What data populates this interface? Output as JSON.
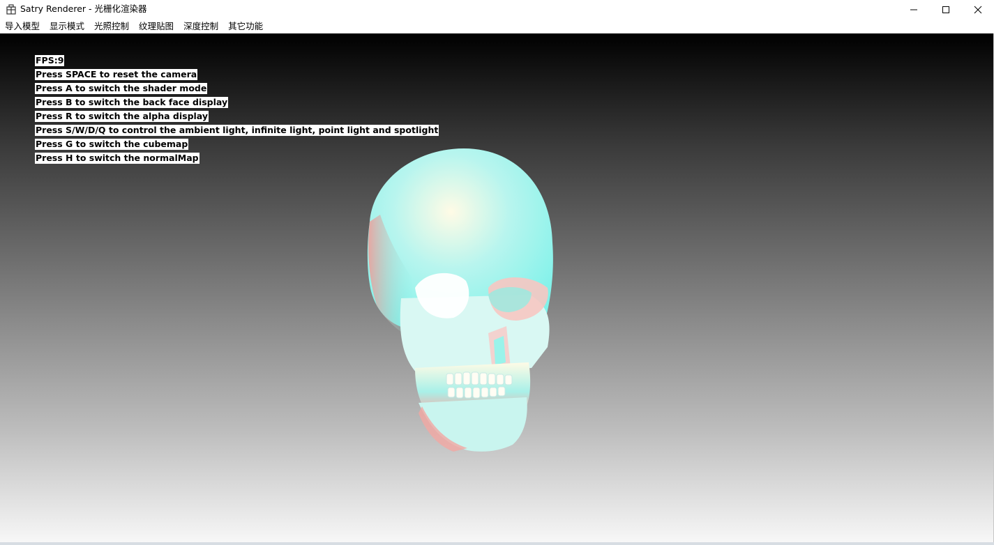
{
  "window": {
    "title": "Satry Renderer - 光栅化渲染器",
    "icon": "app-window-icon",
    "controls": [
      "minimize-icon",
      "maximize-icon",
      "close-icon"
    ]
  },
  "menu": {
    "items": [
      "导入模型",
      "显示模式",
      "光照控制",
      "纹理贴图",
      "深度控制",
      "其它功能"
    ]
  },
  "viewport": {
    "background_gradient": [
      "#000000",
      "#f7f7f7"
    ],
    "hud_lines": [
      "FPS:9",
      "Press SPACE to reset the camera",
      "Press A to switch the shader mode",
      "Press B to switch the back face display",
      "Press R to switch the alpha display",
      "Press S/W/D/Q to control the ambient light, infinite light, point light and spotlight",
      "Press G to switch the cubemap",
      "Press H to switch the normalMap"
    ],
    "model": "skull",
    "model_colors": [
      "#7ff2ea",
      "#f29a96",
      "#fffbe6"
    ]
  }
}
